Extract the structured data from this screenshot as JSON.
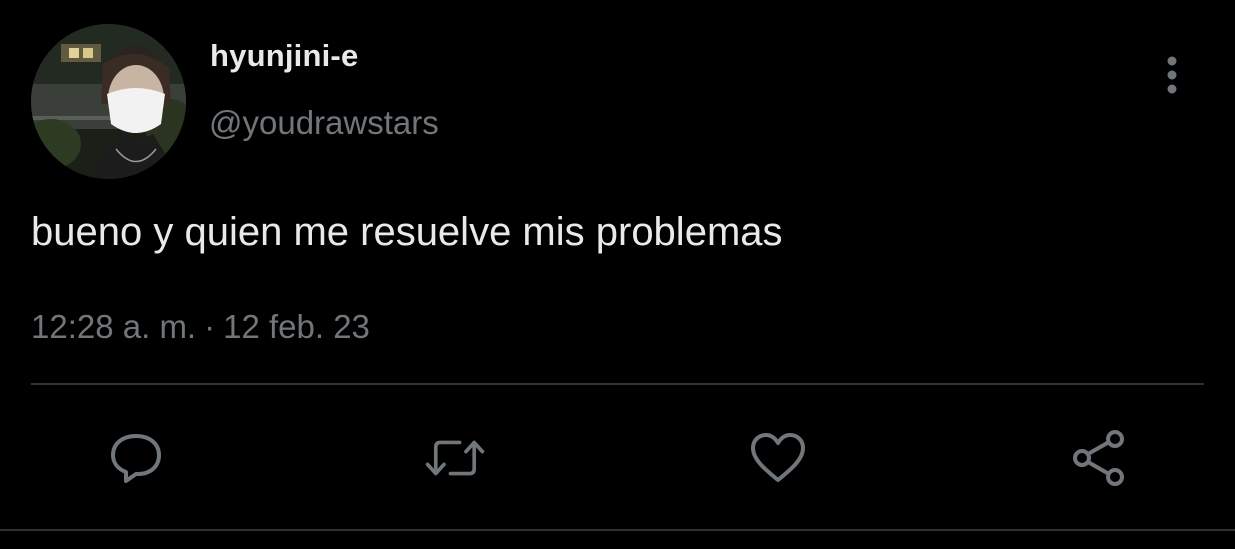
{
  "user": {
    "display_name": "hyunjini-e",
    "handle": "@youdrawstars",
    "avatar_icon": "profile-photo"
  },
  "tweet": {
    "text": "bueno y quien me resuelve mis problemas",
    "time": "12:28 a. m.",
    "separator": "·",
    "date": "12 feb. 23"
  },
  "actions": {
    "reply_icon": "speech-bubble-icon",
    "retweet_icon": "retweet-icon",
    "like_icon": "heart-icon",
    "share_icon": "share-icon",
    "more_icon": "vertical-ellipsis-icon"
  },
  "colors": {
    "background": "#000000",
    "text_primary": "#e7e9ea",
    "text_secondary": "#71767b",
    "divider": "#2f3336"
  }
}
